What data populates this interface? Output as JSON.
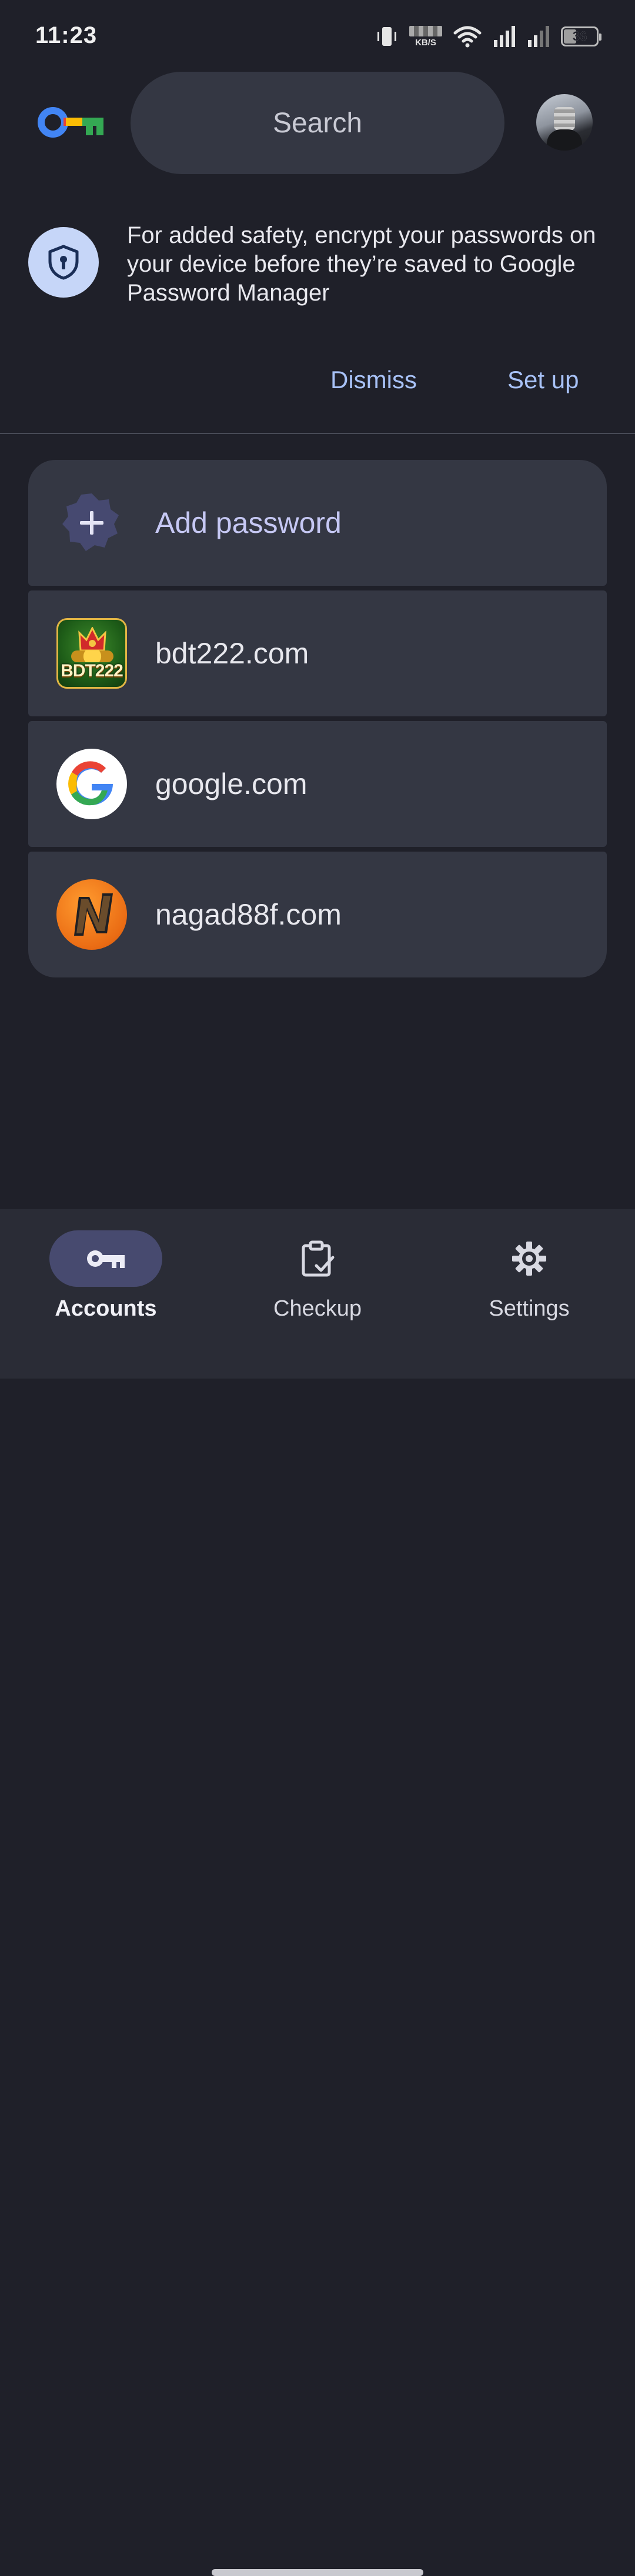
{
  "status_bar": {
    "time": "11:23",
    "net_speed_unit": "KB/S",
    "battery": "36"
  },
  "header": {
    "search_placeholder": "Search"
  },
  "banner": {
    "text": "For added safety, encrypt your passwords on your device before they’re saved to Google Password Manager",
    "dismiss_label": "Dismiss",
    "setup_label": "Set up"
  },
  "list": {
    "add_label": "Add password",
    "items": [
      {
        "site": "bdt222.com",
        "icon": "bdt222-site-icon",
        "icon_text": "BDT222"
      },
      {
        "site": "google.com",
        "icon": "google-site-icon"
      },
      {
        "site": "nagad88f.com",
        "icon": "nagad-site-icon"
      }
    ]
  },
  "bottom_nav": {
    "items": [
      {
        "label": "Accounts",
        "icon": "key-icon",
        "selected": true
      },
      {
        "label": "Checkup",
        "icon": "clipboard-check-icon",
        "selected": false
      },
      {
        "label": "Settings",
        "icon": "gear-icon",
        "selected": false
      }
    ]
  },
  "colors": {
    "background": "#1f2029",
    "surface": "#343743",
    "accent_text": "#a8c2f7",
    "nav_indicator": "#474a6f"
  }
}
